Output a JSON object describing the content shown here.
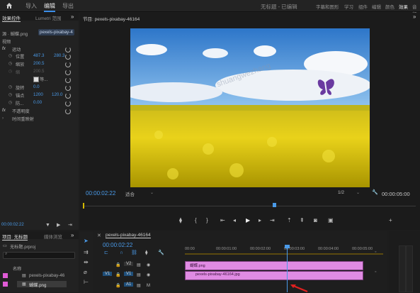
{
  "topbar": {
    "home_icon": "home-icon",
    "nav": [
      "导入",
      "编辑",
      "导出"
    ],
    "active_nav": "编辑",
    "doc_title": "无标题 - 已编辑",
    "workspaces": [
      "字幕和图形",
      "学习",
      "组件",
      "编辑",
      "颜色",
      "效果",
      "音频"
    ],
    "active_workspace": "效果"
  },
  "effect_controls": {
    "tabs": [
      "效果控件",
      "Lumetri 范围"
    ],
    "source": "源 · 蝴蝶.png",
    "sequence": "pexels-pixabay-4",
    "video_label": "视频",
    "motion": "运动",
    "position_label": "位置",
    "position_x": "487.3",
    "position_y": "280.3",
    "scale_label": "缩放",
    "scale_value": "200.5",
    "scale_width_label": "缩",
    "scale_width_value": "200.5",
    "uniform_label": "等...",
    "rotation_label": "旋转",
    "rotation_value": "0.0",
    "anchor_label": "锚点",
    "anchor_x": "1200",
    "anchor_y": "120.0",
    "antiflicker_label": "防...",
    "antiflicker_value": "0.00",
    "opacity": "不透明度",
    "time_remap": "时间重映射",
    "fx_label": "fx",
    "timecode": "00:00:02:22"
  },
  "program": {
    "title": "节目: pexels-pixabay-46164",
    "timecode": "00:00:02:22",
    "fit": "适合",
    "quality": "1/2",
    "duration": "00:00:05:00",
    "watermark": "shuangwezhang",
    "controls": [
      "marker-icon",
      "in-point-icon",
      "out-point-icon",
      "go-to-in-icon",
      "step-back-icon",
      "play-icon",
      "step-forward-icon",
      "go-to-out-icon",
      "lift-icon",
      "extract-icon",
      "export-frame-icon",
      "compare-icon",
      "add-icon"
    ]
  },
  "project": {
    "tabs": [
      "项目: 无标题",
      "媒体浏览"
    ],
    "project_file": "无标题.prproj",
    "col_name": "名称",
    "items": [
      {
        "name": "pexels-pixabay-46",
        "color": "#e05bd6"
      },
      {
        "name": "蝴蝶.png",
        "color": "#e05bd6"
      }
    ]
  },
  "timeline": {
    "title": "pexels-pixabay-46164",
    "timecode": "00:00:02:22",
    "ruler": [
      "00:00",
      "00:00:01:00",
      "00:00:02:00",
      "00:00:03:00",
      "00:00:04:00",
      "00:00:05:00"
    ],
    "tracks": [
      {
        "name": "V2",
        "clip": "蝴蝶.png"
      },
      {
        "name": "V1",
        "clip": "pexels-pixabay-46164.jpg"
      },
      {
        "name": "A1",
        "clip": ""
      }
    ],
    "clip_color": "#e08be3",
    "playhead_color": "#4a9ae8"
  }
}
